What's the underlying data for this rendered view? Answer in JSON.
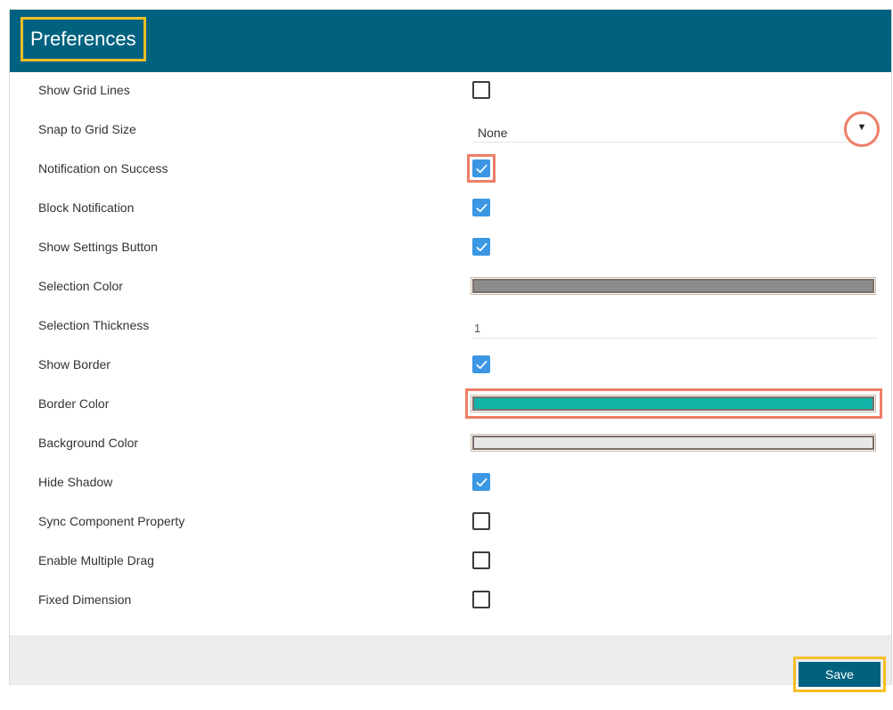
{
  "header": {
    "title": "Preferences"
  },
  "colors": {
    "header_bg": "#00627f",
    "title_highlight": "#f4be24",
    "annotation_highlight": "#ee7f66",
    "checkbox_checked": "#3b97e3",
    "selection_color": "#8c8c8c",
    "border_color": "#14b3a8",
    "background_color": "#e6e6e6",
    "footer_bg": "#ececec"
  },
  "settings": [
    {
      "label": "Show Grid Lines",
      "type": "checkbox",
      "checked": false
    },
    {
      "label": "Snap to Grid Size",
      "type": "select",
      "value": "None",
      "arrow": "▼"
    },
    {
      "label": "Notification on Success",
      "type": "checkbox",
      "checked": true,
      "highlighted": true
    },
    {
      "label": "Block Notification",
      "type": "checkbox",
      "checked": true
    },
    {
      "label": "Show Settings Button",
      "type": "checkbox",
      "checked": true
    },
    {
      "label": "Selection Color",
      "type": "color",
      "value": "#8c8c8c"
    },
    {
      "label": "Selection Thickness",
      "type": "text",
      "value": "1"
    },
    {
      "label": "Show Border",
      "type": "checkbox",
      "checked": true
    },
    {
      "label": "Border Color",
      "type": "color",
      "value": "#14b3a8",
      "highlighted": true
    },
    {
      "label": "Background Color",
      "type": "color",
      "value": "#e6e6e6"
    },
    {
      "label": "Hide Shadow",
      "type": "checkbox",
      "checked": true
    },
    {
      "label": "Sync Component Property",
      "type": "checkbox",
      "checked": false
    },
    {
      "label": "Enable Multiple Drag",
      "type": "checkbox",
      "checked": false
    },
    {
      "label": "Fixed Dimension",
      "type": "checkbox",
      "checked": false
    }
  ],
  "footer": {
    "save_label": "Save"
  }
}
